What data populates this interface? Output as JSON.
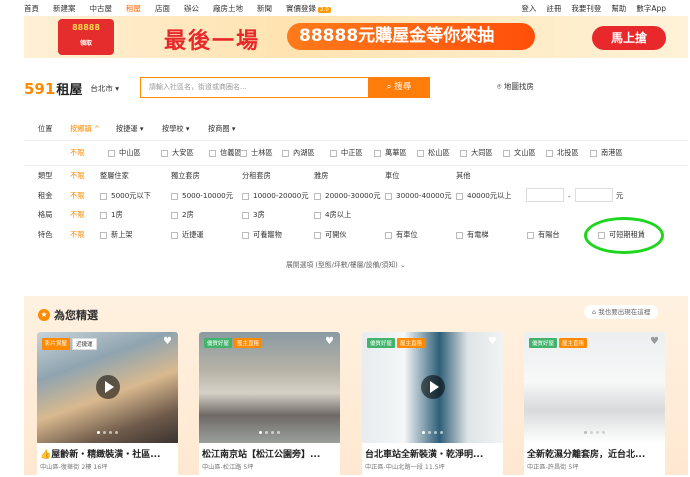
{
  "topnav": {
    "left": [
      "首頁",
      "新建案",
      "中古屋",
      "租屋",
      "店面",
      "辦公",
      "廠房土地",
      "新聞",
      "實價登錄"
    ],
    "active_index": 3,
    "badge": "2.0",
    "right": [
      "登入",
      "註冊",
      "我要刊登",
      "幫助",
      "數字App"
    ]
  },
  "banner": {
    "gift_amount": "88888",
    "gift_sub": "領取",
    "headline": "最後一場",
    "pill_text": "88888元購屋金等你來抽",
    "cta": "馬上搶"
  },
  "header": {
    "logo_num": "591",
    "logo_text": "租屋",
    "city": "台北市",
    "search_placeholder": "請輸入社區名，街道或商圈名...",
    "search_button": "搜尋",
    "map_link": "地圖找房"
  },
  "filters": {
    "position_label": "位置",
    "position_tabs": [
      "按鄉鎮",
      "按捷運",
      "按學校",
      "按商圈"
    ],
    "nolimit": "不限",
    "districts": [
      "中山區",
      "大安區",
      "信義區",
      "士林區",
      "內湖區",
      "中正區",
      "萬華區",
      "松山區",
      "大同區",
      "文山區",
      "北投區",
      "南港區"
    ],
    "type_label": "類型",
    "types": [
      "整層住家",
      "獨立套房",
      "分租套房",
      "雅房",
      "車位",
      "其他"
    ],
    "rent_label": "租金",
    "rents": [
      "5000元以下",
      "5000-10000元",
      "10000-20000元",
      "20000-30000元",
      "30000-40000元",
      "40000元以上"
    ],
    "rent_unit": "元",
    "rent_dash": "-",
    "layout_label": "格局",
    "layouts": [
      "1房",
      "2房",
      "3房",
      "4房以上"
    ],
    "feature_label": "特色",
    "features": [
      "新上架",
      "近捷運",
      "可養寵物",
      "可開伙",
      "有車位",
      "有電梯",
      "有陽台",
      "可短期租賃"
    ],
    "expand": "展開選項",
    "expand_hint": "(型態/坪數/樓層/設備/須知)"
  },
  "recommend": {
    "title": "為您精選",
    "want": "我也要出現在這裡",
    "cards": [
      {
        "tags": [
          "影片賞屋",
          "近捷運"
        ],
        "title": "屋齡新・精緻裝潢・社區...",
        "meta": "中山區-復華街 2樓 16坪"
      },
      {
        "tags": [
          "優質好屋",
          "屋主直租"
        ],
        "title": "松江南京站【松江公園旁】...",
        "meta": "中山區-松江路 5坪"
      },
      {
        "tags": [
          "優質好屋",
          "屋主直租"
        ],
        "title": "台北車站全新裝潢・乾淨明...",
        "meta": "中正區-中山北路一段 11.5坪"
      },
      {
        "tags": [
          "優質好屋",
          "屋主直租"
        ],
        "title": "全新乾濕分離套房，近台北...",
        "meta": "中正區-許昌街 5坪"
      }
    ]
  },
  "colors": {
    "accent": "#ff8a00",
    "highlight_circle": "#1ed61e"
  }
}
